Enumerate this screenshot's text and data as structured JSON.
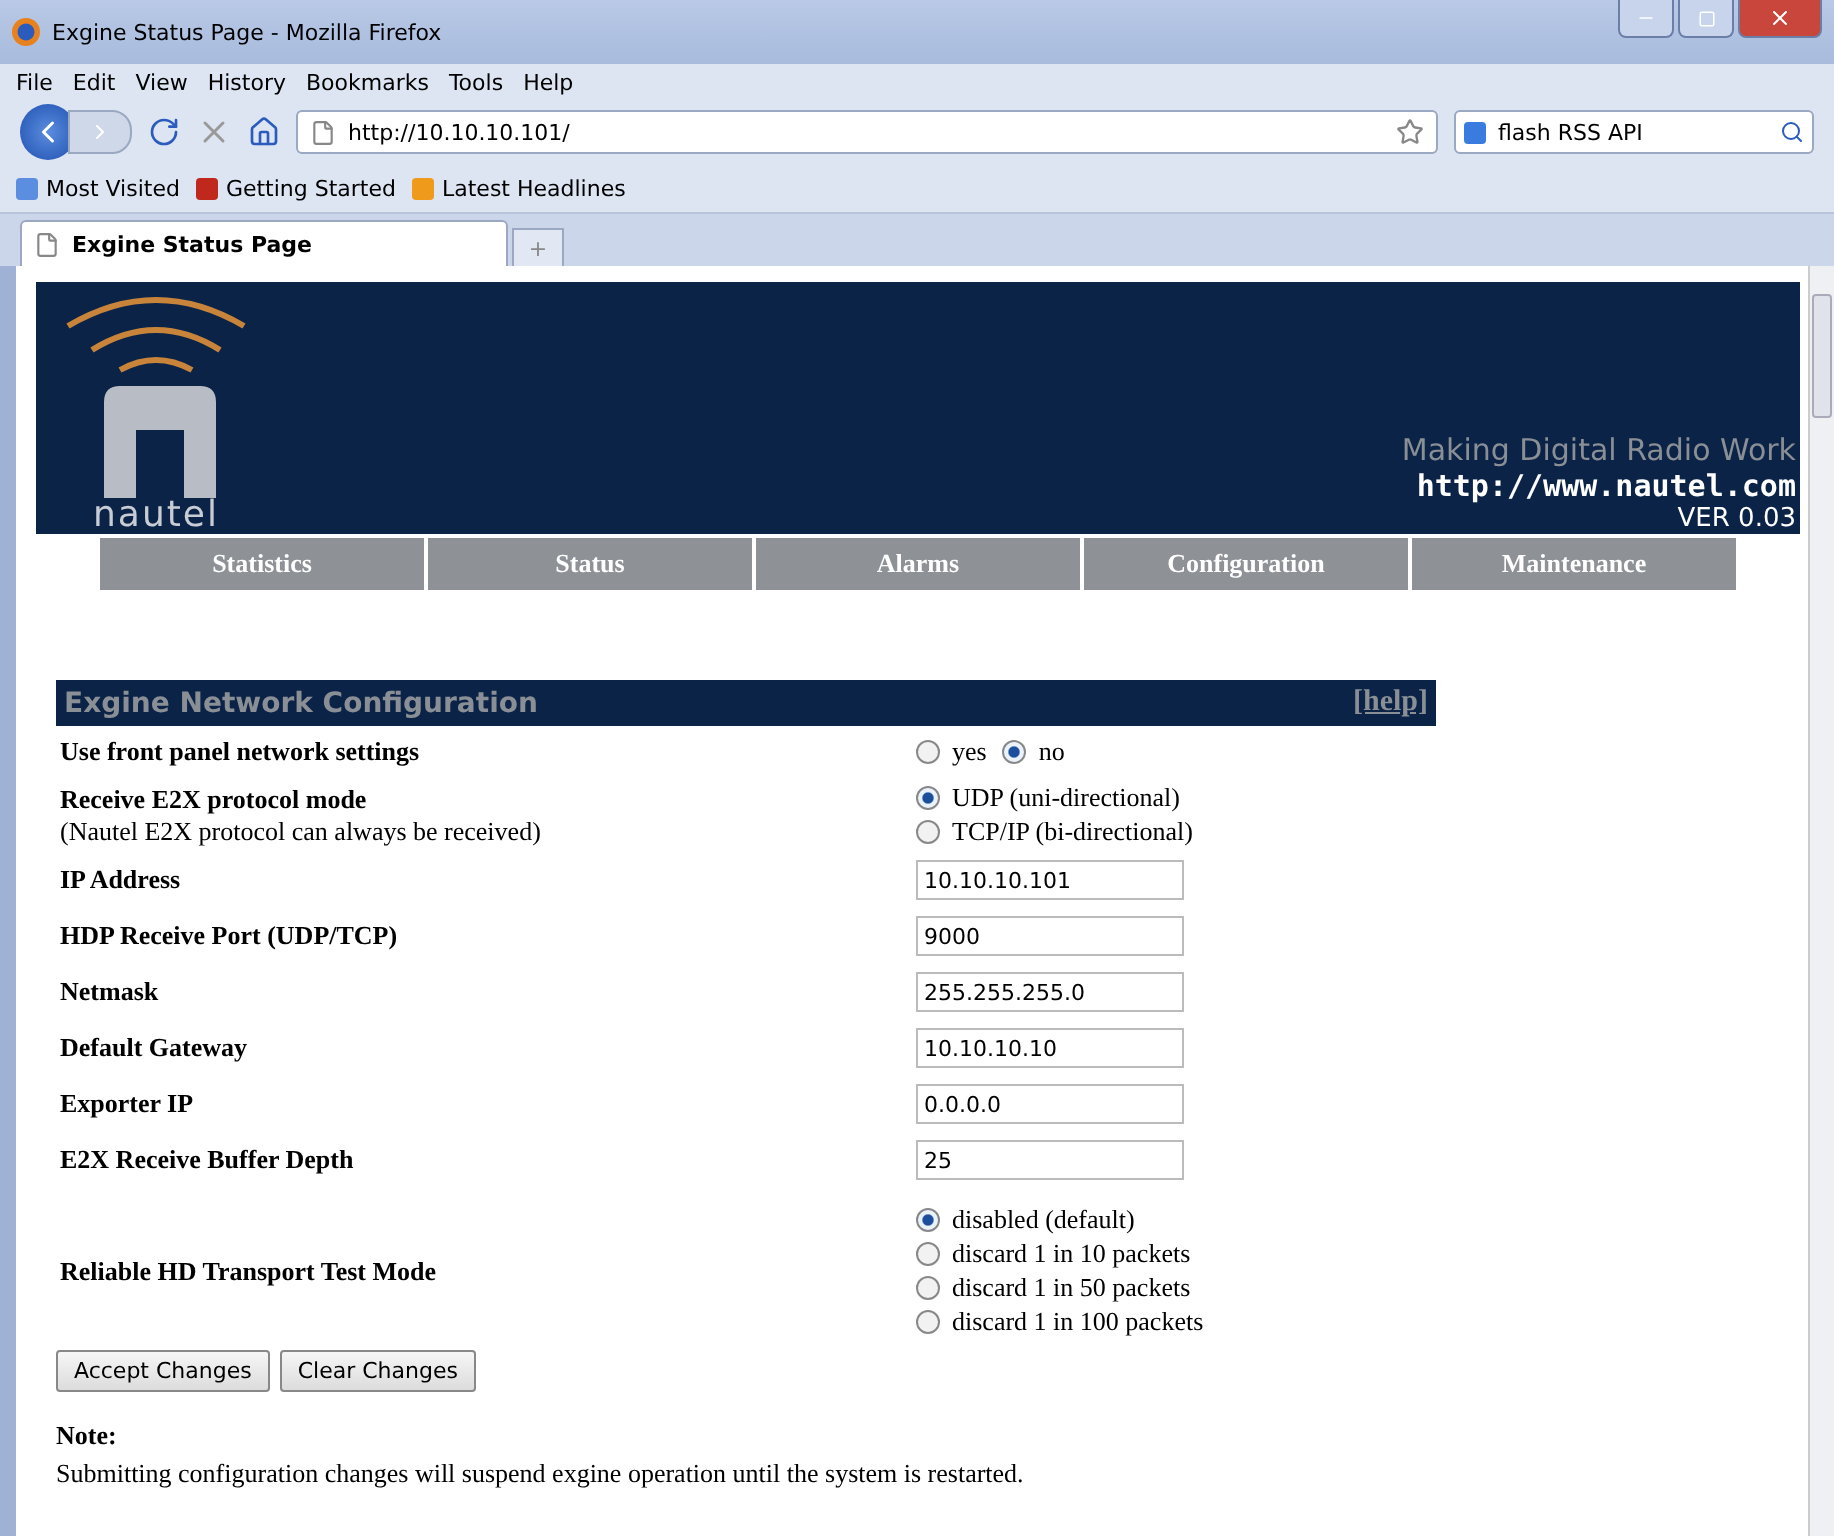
{
  "browser": {
    "title": "Exgine Status Page - Mozilla Firefox",
    "menu": [
      "File",
      "Edit",
      "View",
      "History",
      "Bookmarks",
      "Tools",
      "Help"
    ],
    "url": "http://10.10.10.101/",
    "search": "flash RSS API",
    "bookmarks": [
      "Most Visited",
      "Getting Started",
      "Latest Headlines"
    ],
    "tab": "Exgine Status Page",
    "new_tab": "+"
  },
  "header": {
    "logo_text": "nautel",
    "tagline": "Making Digital Radio Work",
    "site": "http://www.nautel.com",
    "version": "VER 0.03"
  },
  "nav": [
    {
      "label": "Statistics"
    },
    {
      "label": "Status"
    },
    {
      "label": "Alarms"
    },
    {
      "label": "Configuration"
    },
    {
      "label": "Maintenance"
    }
  ],
  "section": {
    "title": "Exgine Network Configuration",
    "help": "[help]"
  },
  "rows": [
    {
      "kind": "radio_inline",
      "label": "Use front panel network settings",
      "options": [
        {
          "label": "yes",
          "selected": false
        },
        {
          "label": "no",
          "selected": true
        }
      ]
    },
    {
      "kind": "radio_stack",
      "label": "Receive E2X protocol mode",
      "note": "(Nautel E2X protocol can always be received)",
      "options": [
        {
          "label": "UDP (uni-directional)",
          "selected": true
        },
        {
          "label": "TCP/IP (bi-directional)",
          "selected": false
        }
      ]
    },
    {
      "kind": "text",
      "label": "IP Address",
      "value": "10.10.10.101"
    },
    {
      "kind": "text",
      "label": "HDP Receive Port (UDP/TCP)",
      "value": "9000"
    },
    {
      "kind": "text",
      "label": "Netmask",
      "value": "255.255.255.0"
    },
    {
      "kind": "text",
      "label": "Default Gateway",
      "value": "10.10.10.10"
    },
    {
      "kind": "text",
      "label": "Exporter IP",
      "value": "0.0.0.0"
    },
    {
      "kind": "text",
      "label": "E2X Receive Buffer Depth",
      "value": "25"
    },
    {
      "kind": "radio_stack",
      "label": "Reliable HD Transport Test Mode",
      "options": [
        {
          "label": "disabled (default)",
          "selected": true
        },
        {
          "label": "discard 1 in 10 packets",
          "selected": false
        },
        {
          "label": "discard 1 in 50 packets",
          "selected": false
        },
        {
          "label": "discard 1 in 100 packets",
          "selected": false
        }
      ]
    }
  ],
  "buttons": [
    "Accept Changes",
    "Clear Changes"
  ],
  "note": {
    "title": "Note:",
    "text": "Submitting configuration changes will suspend exgine operation until the system is restarted."
  }
}
